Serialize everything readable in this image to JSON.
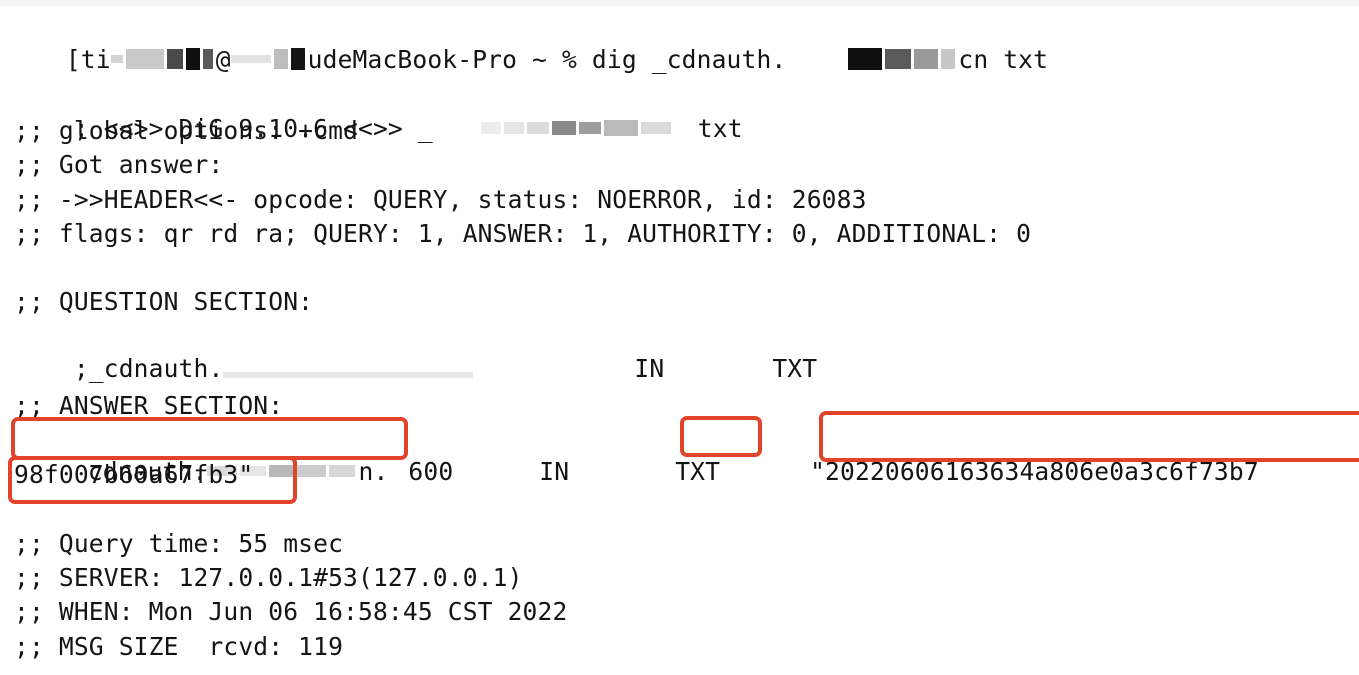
{
  "terminal": {
    "prompt_user_visible": "[ti",
    "prompt_host_visible": "udeMacBook-Pro",
    "prompt_dir": "~",
    "prompt_symbol": "%",
    "command": "dig _cdnauth.",
    "command_suffix": "cn txt",
    "dig_banner_prefix": "; <<>> DiG 9.10.6 <<>> _",
    "dig_banner_suffix": "txt",
    "global_options": ";; global options: +cmd",
    "got_answer": ";; Got answer:",
    "header": ";; ->>HEADER<<- opcode: QUERY, status: NOERROR, id: 26083",
    "flags": ";; flags: qr rd ra; QUERY: 1, ANSWER: 1, AUTHORITY: 0, ADDITIONAL: 0",
    "question_section": {
      "heading": ";; QUESTION SECTION:",
      "name_visible": ";_cdnauth.",
      "class": "IN",
      "type": "TXT"
    },
    "answer_section": {
      "heading": ";; ANSWER SECTION:",
      "name_visible": "cdnauth.",
      "name_end": "n.",
      "ttl": "600",
      "class": "IN",
      "type": "TXT",
      "value_line1": "\"20220606163634a806e0a3c6f73b7",
      "value_line2": "98f007b60a67fb3\""
    },
    "query_time": ";; Query time: 55 msec",
    "server": ";; SERVER: 127.0.0.1#53(127.0.0.1)",
    "when": ";; WHEN: Mon Jun 06 16:58:45 CST 2022",
    "msg_size": ";; MSG SIZE  rcvd: 119"
  },
  "colors": {
    "text": "#141414",
    "highlight_box": "#e0452c",
    "background": "#ffffff"
  }
}
